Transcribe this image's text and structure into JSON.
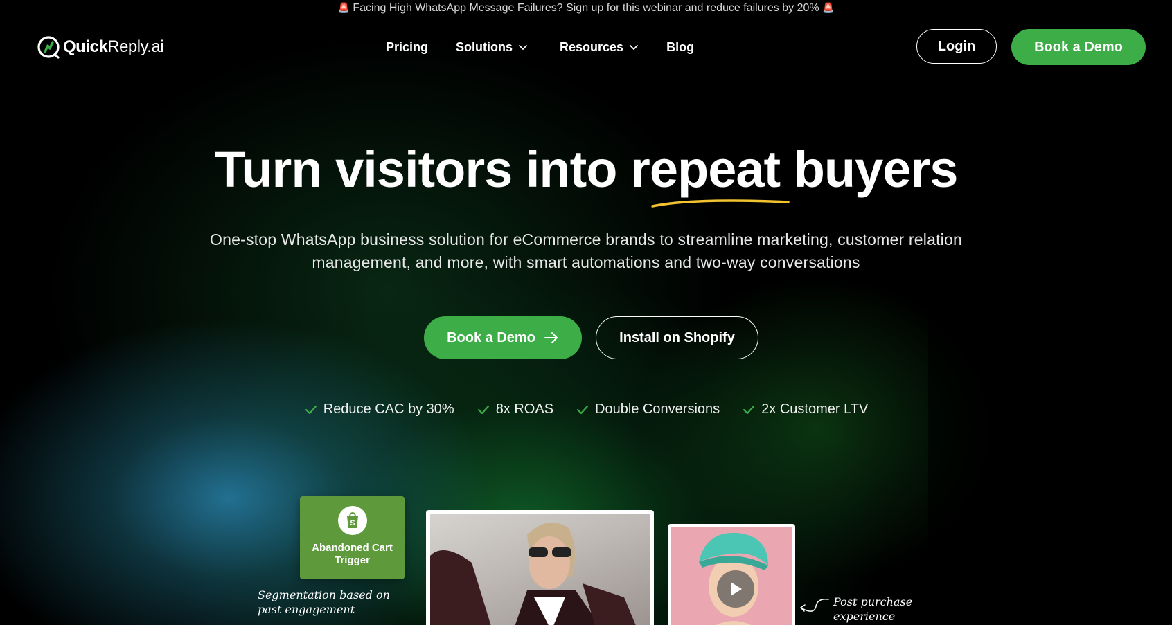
{
  "announcement": {
    "text": "Facing High WhatsApp Message Failures? Sign up for this webinar and reduce failures by 20%",
    "icon": "siren-icon"
  },
  "brand": {
    "name_bold": "Quick",
    "name_regular": "Reply.ai",
    "accent_color": "#3dae47"
  },
  "nav": {
    "items": [
      {
        "label": "Pricing",
        "dropdown": false
      },
      {
        "label": "Solutions",
        "dropdown": true
      },
      {
        "label": "Resources",
        "dropdown": true
      },
      {
        "label": "Blog",
        "dropdown": false
      }
    ],
    "login_label": "Login",
    "demo_label": "Book a Demo"
  },
  "hero": {
    "headline_before": "Turn visitors into",
    "headline_accent": "repeat",
    "headline_after": "buyers",
    "subtitle": "One-stop WhatsApp business solution for eCommerce brands to streamline marketing, customer relation management, and more, with smart automations and two-way conversations",
    "cta_primary": "Book a Demo",
    "cta_secondary": "Install on Shopify",
    "benefits": [
      "Reduce CAC by 30%",
      "8x ROAS",
      "Double Conversions",
      "2x Customer LTV"
    ]
  },
  "visual": {
    "trigger_card_label": "Abandoned Cart Trigger",
    "note_left": "Segmentation based on past engagement",
    "note_right": "Post purchase experience"
  }
}
